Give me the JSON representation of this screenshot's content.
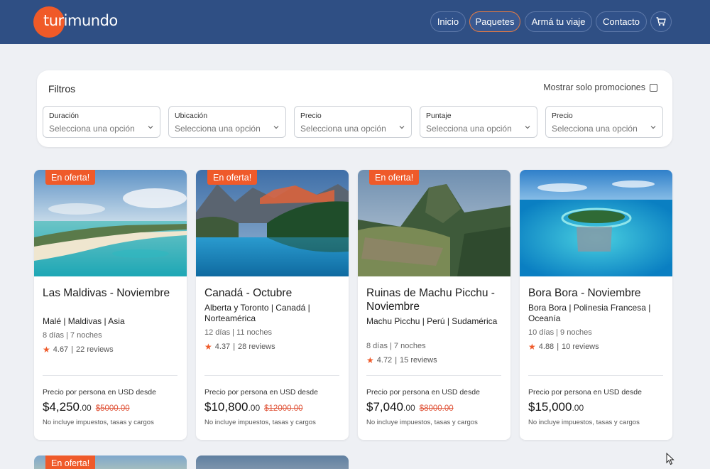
{
  "header": {
    "logo_part1": "turi",
    "logo_part2": "mundo",
    "nav": [
      "Inicio",
      "Paquetes",
      "Armá tu viaje",
      "Contacto"
    ],
    "active_nav": "Paquetes",
    "cart_icon": "cart-icon"
  },
  "filters": {
    "title": "Filtros",
    "promo_label": "Mostrar solo promociones",
    "promo_checked": false,
    "selects": [
      {
        "label": "Duración",
        "placeholder": "Selecciona una opción"
      },
      {
        "label": "Ubicación",
        "placeholder": "Selecciona una opción"
      },
      {
        "label": "Precio",
        "placeholder": "Selecciona una opción"
      },
      {
        "label": "Puntaje",
        "placeholder": "Selecciona una opción"
      },
      {
        "label": "Precio",
        "placeholder": "Selecciona una opción"
      }
    ]
  },
  "cards": [
    {
      "badge": "En oferta!",
      "title": "Las Maldivas - Noviembre",
      "location": "Malé | Maldivas | Asia",
      "duration": "8 días | 7 noches",
      "rating": "4.67",
      "reviews": "22 reviews",
      "price_label": "Precio por persona en USD desde",
      "price": "$4,250",
      "cents": ".00",
      "old_price": "$5000.00",
      "note": "No incluye impuestos, tasas y cargos"
    },
    {
      "badge": "En oferta!",
      "title": "Canadá - Octubre",
      "location": "Alberta y Toronto | Canadá | Norteamérica",
      "duration": "12 días | 11 noches",
      "rating": "4.37",
      "reviews": "28 reviews",
      "price_label": "Precio por persona en USD desde",
      "price": "$10,800",
      "cents": ".00",
      "old_price": "$12000.00",
      "note": "No incluye impuestos, tasas y cargos"
    },
    {
      "badge": "En oferta!",
      "title": "Ruinas de Machu Picchu - Noviembre",
      "location": "Machu Picchu | Perú | Sudamérica",
      "duration": "8 días | 7 noches",
      "rating": "4.72",
      "reviews": "15 reviews",
      "price_label": "Precio por persona en USD desde",
      "price": "$7,040",
      "cents": ".00",
      "old_price": "$8000.00",
      "note": "No incluye impuestos, tasas y cargos"
    },
    {
      "badge": "",
      "title": "Bora Bora - Noviembre",
      "location": "Bora Bora | Polinesia Francesa | Oceanía",
      "duration": "10 días | 9 noches",
      "rating": "4.88",
      "reviews": "10 reviews",
      "price_label": "Precio por persona en USD desde",
      "price": "$15,000",
      "cents": ".00",
      "old_price": "",
      "note": "No incluye impuestos, tasas y cargos"
    }
  ],
  "partial_badge": "En oferta!"
}
